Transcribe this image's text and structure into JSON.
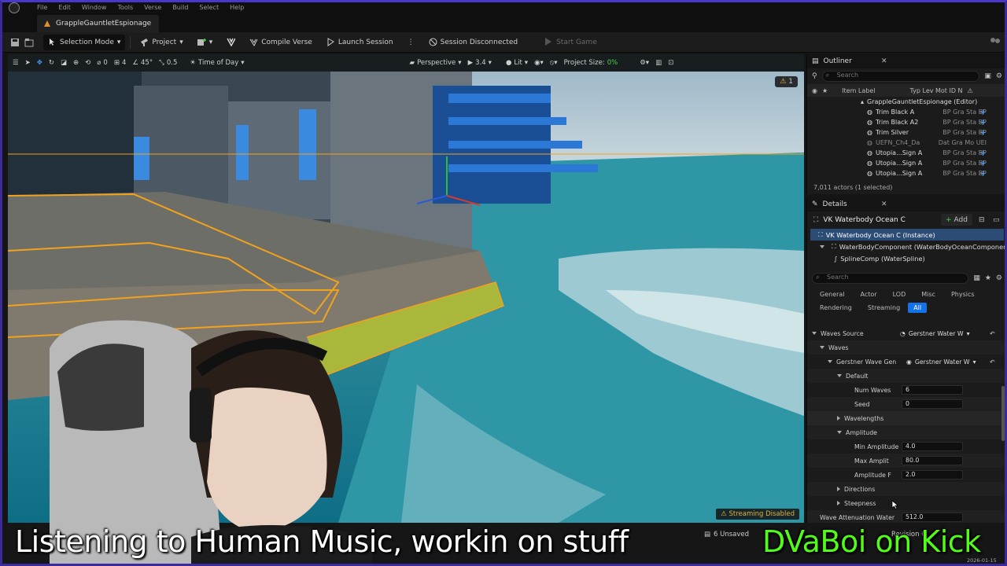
{
  "app": {
    "menu": [
      "File",
      "Edit",
      "Window",
      "Tools",
      "Verse",
      "Build",
      "Select",
      "Help"
    ],
    "project_tab": "GrappleGauntletEspionage"
  },
  "toolbar": {
    "selection_mode": "Selection Mode",
    "project": "Project",
    "compile_verse": "Compile Verse",
    "launch_session": "Launch Session",
    "session_status": "Session Disconnected",
    "start_game": "Start Game"
  },
  "viewport": {
    "snap_rotation": "0",
    "snap_grid": "4",
    "snap_angle": "45°",
    "snap_scale": "0.5",
    "time_of_day": "Time of Day",
    "view_mode": "Perspective",
    "camera_speed": "3.4",
    "lighting": "Lit",
    "project_size_label": "Project Size:",
    "project_size_value": "0%",
    "warning_count": "1",
    "streaming": "Streaming Disabled"
  },
  "outliner": {
    "title": "Outliner",
    "search_placeholder": "Search",
    "col_label": "Item Label",
    "col_rest": "Typ Lev Mot ID N",
    "root": "GrappleGauntletEspionage (Editor)",
    "rows": [
      {
        "label": "Trim Black A",
        "meta": "BP Gra Sta BP"
      },
      {
        "label": "Trim Black A2",
        "meta": "BP Gra Sta BP"
      },
      {
        "label": "Trim Silver",
        "meta": "BP Gra Sta BP"
      },
      {
        "label": "UEFN_Ch4_Da",
        "meta": "Dat Gra Mo UEI"
      },
      {
        "label": "Utopia...Sign A",
        "meta": "BP Gra Sta BP"
      },
      {
        "label": "Utopia...Sign A",
        "meta": "BP Gra Sta BP"
      },
      {
        "label": "Utopia...Sign A",
        "meta": "BP Gra Sta BP"
      }
    ],
    "actor_count": "7,011 actors (1 selected)"
  },
  "details": {
    "title": "Details",
    "actor_name": "VK Waterbody Ocean C",
    "add_label": "Add",
    "instance": "VK Waterbody Ocean C (Instance)",
    "component1": "WaterBodyComponent (WaterBodyOceanComponent",
    "component2": "SplineComp (WaterSpline)",
    "search_placeholder": "Search",
    "categories": [
      "General",
      "Actor",
      "LOD",
      "Misc",
      "Physics",
      "Rendering",
      "Streaming",
      "All"
    ],
    "waves_source_label": "Waves Source",
    "waves_source_value": "Gerstner Water W",
    "waves_label": "Waves",
    "gerstner_label": "Gerstner Wave Gen",
    "gerstner_value": "Gerstner Water W",
    "default_label": "Default",
    "num_waves_label": "Num Waves",
    "num_waves_value": "6",
    "seed_label": "Seed",
    "seed_value": "0",
    "wavelengths_label": "Wavelengths",
    "amplitude_label": "Amplitude",
    "min_amp_label": "Min Amplitude",
    "min_amp_value": "4.0",
    "max_amp_label": "Max Amplit",
    "max_amp_value": "80.0",
    "amp_f_label": "Amplitude F",
    "amp_f_value": "2.0",
    "directions_label": "Directions",
    "steepness_label": "Steepness",
    "attenuation_label": "Wave Attenuation Water",
    "attenuation_value": "512.0"
  },
  "statusbar": {
    "unsaved": "6 Unsaved",
    "revision": "Revision C",
    "date": "2026-01-15"
  },
  "overlay": {
    "caption": "Listening to Human Music, workin on stuff",
    "kick": "DVaBoi on Kick"
  },
  "colors": {
    "accent_blue": "#1473e6",
    "kick_green": "#53fc18",
    "selection_orange": "#f2a21b"
  }
}
